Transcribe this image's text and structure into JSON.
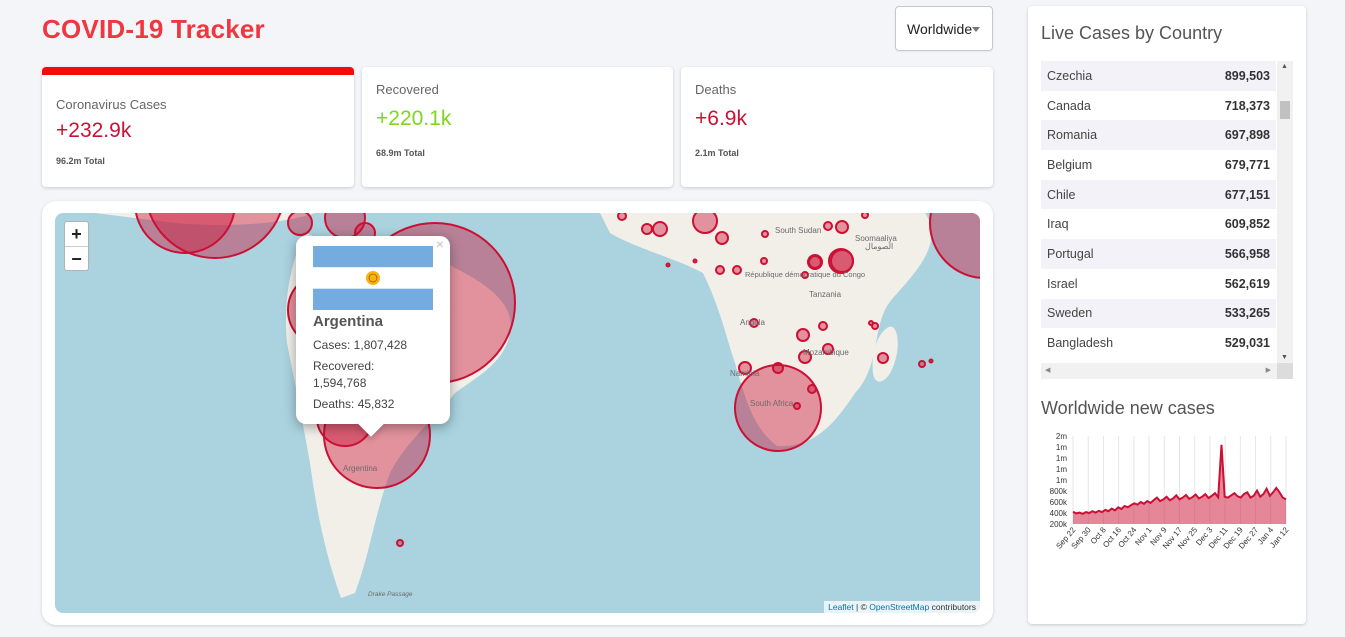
{
  "header": {
    "title": "COVID-19 Tracker"
  },
  "country_select": {
    "selected": "Worldwide"
  },
  "cards": [
    {
      "label": "Coronavirus Cases",
      "value": "+232.9k",
      "total": "96.2m Total",
      "color": "#cc1034",
      "active": true
    },
    {
      "label": "Recovered",
      "value": "+220.1k",
      "total": "68.9m Total",
      "color": "#7dd71d",
      "active": false
    },
    {
      "label": "Deaths",
      "value": "+6.9k",
      "total": "2.1m Total",
      "color": "#cc1034",
      "active": false
    }
  ],
  "map": {
    "zoom_in": "+",
    "zoom_out": "−",
    "labels": [
      "South Sudan",
      "Soomaaliya",
      "الصومال",
      "République démocratique du Congo",
      "Tanzania",
      "Angola",
      "Namibia",
      "South Africa",
      "Argentina",
      "Mozambique",
      "Drake Passage"
    ],
    "attribution": {
      "leaflet": "Leaflet",
      "separator": " | © ",
      "osm": "OpenStreetMap",
      "suffix": " contributors"
    },
    "popup": {
      "country": "Argentina",
      "cases": "Cases: 1,807,428",
      "recovered_label": "Recovered:",
      "recovered_value": "1,594,768",
      "deaths": "Deaths: 45,832",
      "close": "×"
    },
    "colors": {
      "ocean": "#aad3df",
      "land": "#f2efe9",
      "circle": "#cc1034"
    }
  },
  "sidebar": {
    "table_title": "Live Cases by Country",
    "table": [
      {
        "country": "Czechia",
        "cases": "899,503"
      },
      {
        "country": "Canada",
        "cases": "718,373"
      },
      {
        "country": "Romania",
        "cases": "697,898"
      },
      {
        "country": "Belgium",
        "cases": "679,771"
      },
      {
        "country": "Chile",
        "cases": "677,151"
      },
      {
        "country": "Iraq",
        "cases": "609,852"
      },
      {
        "country": "Portugal",
        "cases": "566,958"
      },
      {
        "country": "Israel",
        "cases": "562,619"
      },
      {
        "country": "Sweden",
        "cases": "533,265"
      },
      {
        "country": "Bangladesh",
        "cases": "529,031"
      }
    ],
    "chart_title": "Worldwide new cases"
  },
  "chart_data": {
    "type": "area",
    "title": "Worldwide new cases",
    "y_tick_labels": [
      "2m",
      "1m",
      "1m",
      "1m",
      "1m",
      "800k",
      "600k",
      "400k",
      "200k"
    ],
    "x_tick_labels": [
      "Sep 22",
      "Sep 30",
      "Oct 8",
      "Oct 16",
      "Oct 24",
      "Nov 1",
      "Nov 9",
      "Nov 17",
      "Nov 25",
      "Dec 3",
      "Dec 11",
      "Dec 19",
      "Dec 27",
      "Jan 4",
      "Jan 12"
    ],
    "ylim": [
      0,
      2000000
    ],
    "color": "#cc1034",
    "series": [
      {
        "values": [
          280000,
          240000,
          260000,
          230000,
          270000,
          250000,
          290000,
          260000,
          300000,
          270000,
          320000,
          290000,
          350000,
          310000,
          380000,
          340000,
          410000,
          380000,
          430000,
          470000,
          440000,
          500000,
          460000,
          520000,
          480000,
          540000,
          600000,
          520000,
          560000,
          620000,
          540000,
          580000,
          650000,
          560000,
          600000,
          660000,
          570000,
          610000,
          670000,
          580000,
          620000,
          680000,
          590000,
          640000,
          700000,
          610000,
          1800000,
          620000,
          600000,
          650000,
          700000,
          630000,
          600000,
          680000,
          720000,
          600000,
          640000,
          760000,
          620000,
          680000,
          800000,
          640000,
          720000,
          820000,
          720000,
          600000,
          560000
        ]
      }
    ]
  }
}
